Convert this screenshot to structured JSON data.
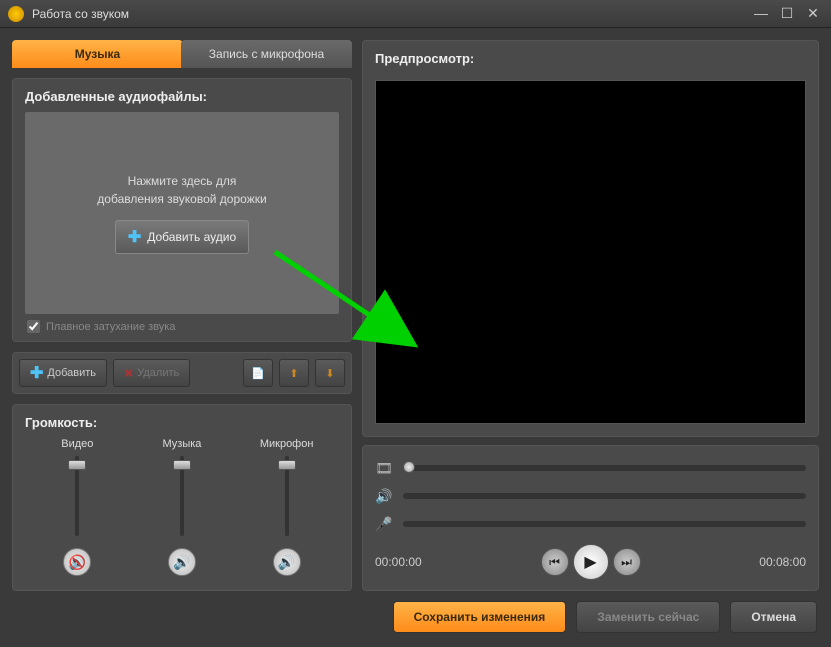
{
  "window": {
    "title": "Работа со звуком"
  },
  "tabs": {
    "music": "Музыка",
    "mic": "Запись с микрофона"
  },
  "audioPanel": {
    "title": "Добавленные аудиофайлы:",
    "hint_line1": "Нажмите здесь для",
    "hint_line2": "добавления звуковой дорожки",
    "addBtn": "Добавить аудио",
    "fadeLabel": "Плавное затухание звука"
  },
  "toolbar": {
    "add": "Добавить",
    "remove": "Удалить"
  },
  "volume": {
    "title": "Громкость:",
    "video": "Видео",
    "music": "Музыка",
    "mic": "Микрофон"
  },
  "preview": {
    "title": "Предпросмотр:"
  },
  "time": {
    "current": "00:00:00",
    "total": "00:08:00"
  },
  "buttons": {
    "save": "Сохранить изменения",
    "replace": "Заменить сейчас",
    "cancel": "Отмена"
  }
}
